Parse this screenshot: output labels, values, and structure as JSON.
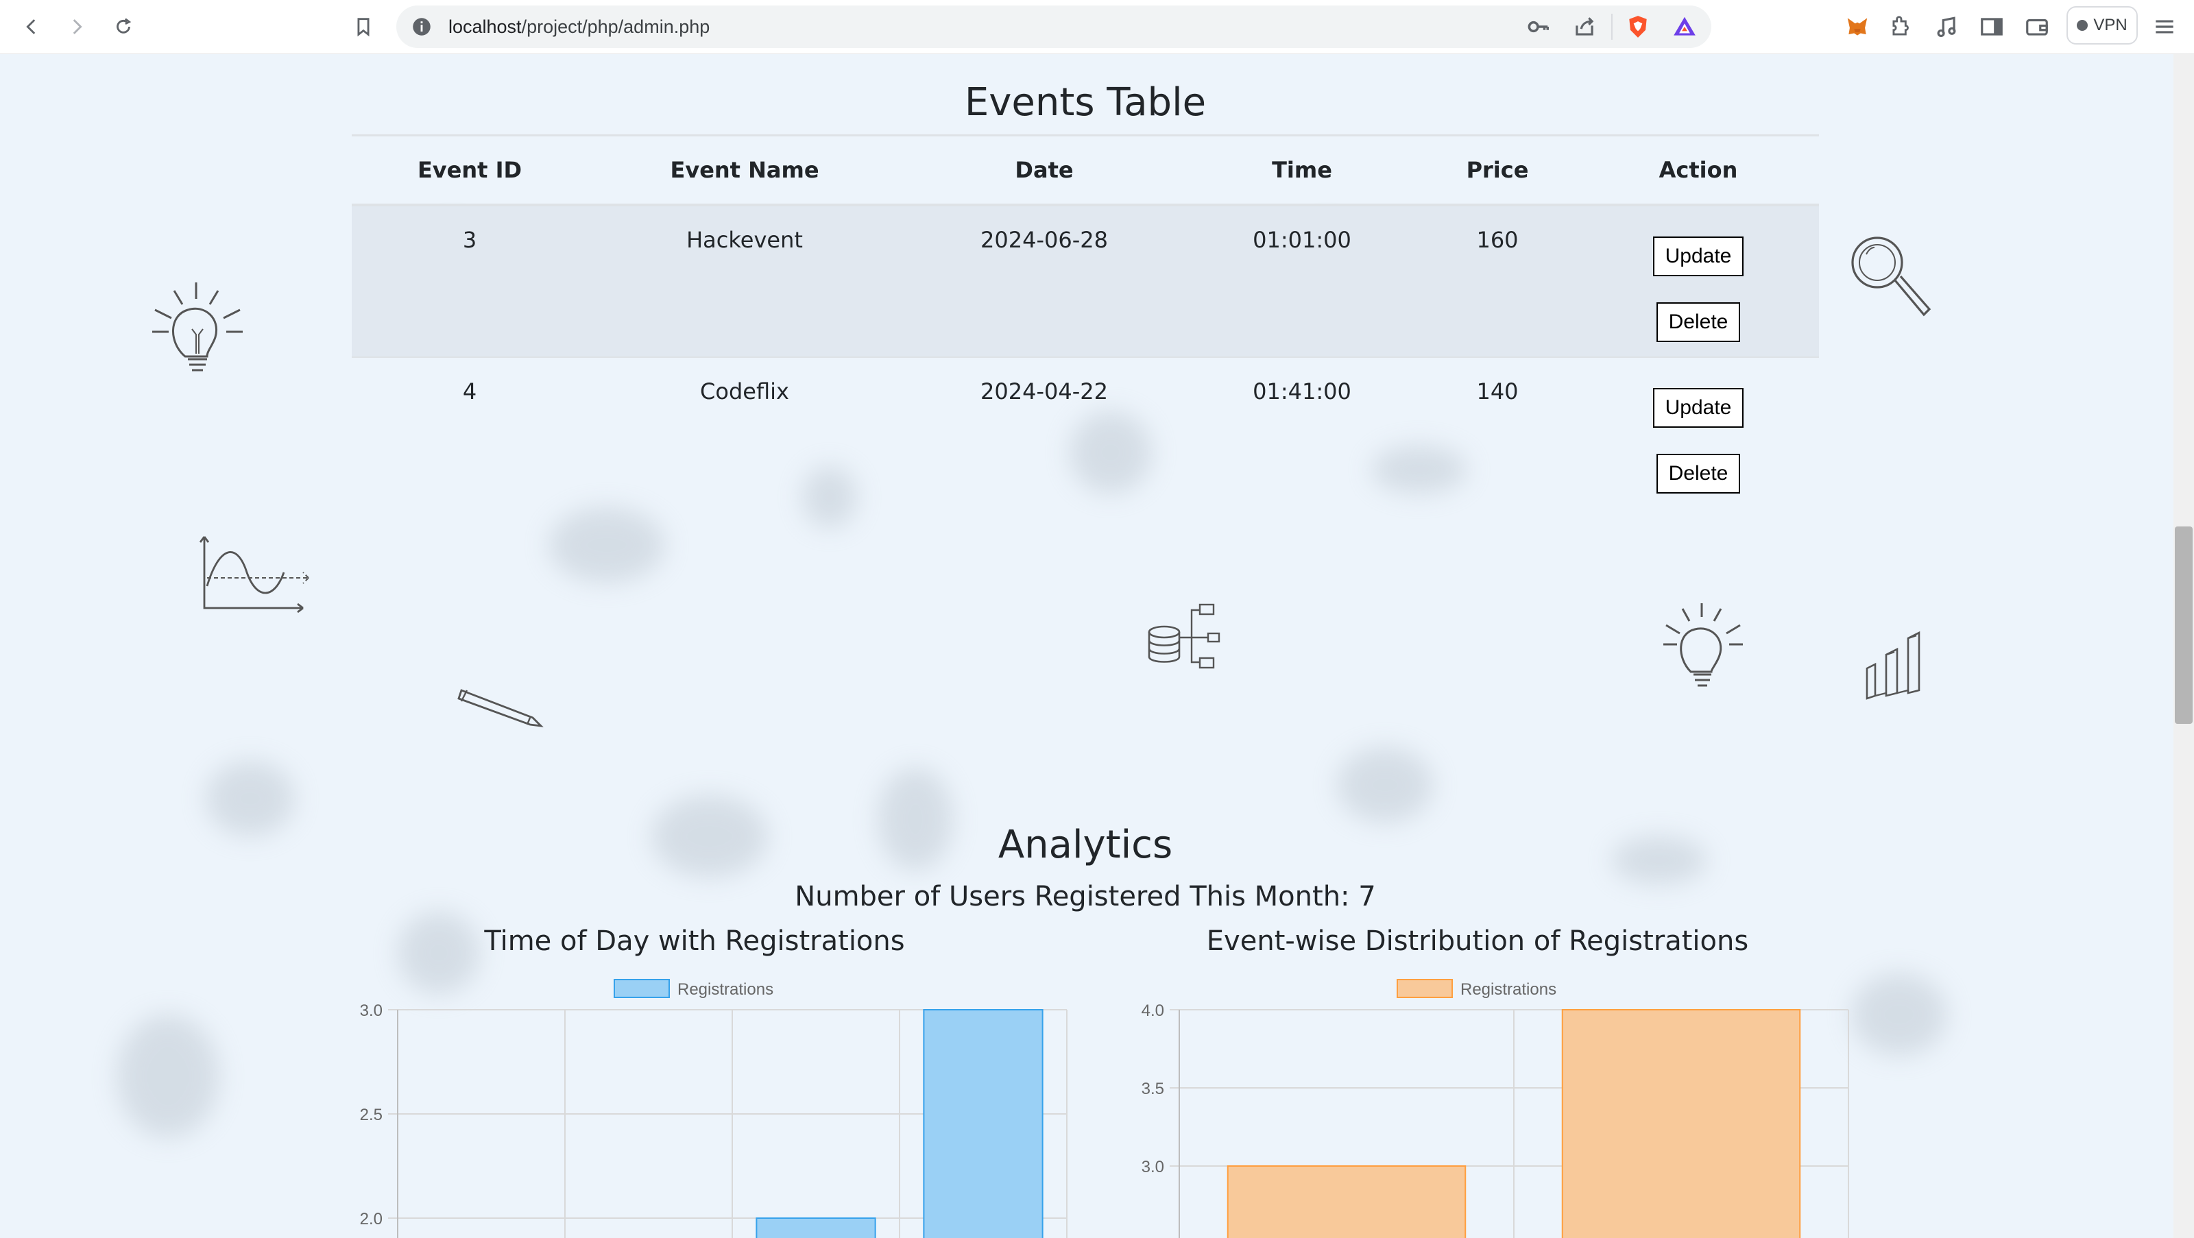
{
  "browser": {
    "url_host": "localhost",
    "url_path": "/project/php/admin.php",
    "vpn_label": "VPN",
    "icons": [
      "back-icon",
      "forward-icon",
      "reload-icon",
      "bookmark-icon",
      "info-icon",
      "key-icon",
      "share-icon",
      "brave-shield-icon",
      "brave-rewards-icon",
      "metamask-icon",
      "extensions-icon",
      "media-icon",
      "sidebar-icon",
      "wallet-icon",
      "menu-icon"
    ]
  },
  "events": {
    "title": "Events Table",
    "columns": [
      "Event ID",
      "Event Name",
      "Date",
      "Time",
      "Price",
      "Action"
    ],
    "rows": [
      {
        "id": "3",
        "name": "Hackevent",
        "date": "2024-06-28",
        "time": "01:01:00",
        "price": "160"
      },
      {
        "id": "4",
        "name": "Codeflix",
        "date": "2024-04-22",
        "time": "01:41:00",
        "price": "140"
      }
    ],
    "update_label": "Update",
    "delete_label": "Delete"
  },
  "analytics": {
    "title": "Analytics",
    "users_line": "Number of Users Registered This Month: 7"
  },
  "chart_data": [
    {
      "type": "bar",
      "title": "Time of Day with Registrations",
      "series": [
        {
          "name": "Registrations",
          "values": [
            null,
            null,
            2,
            3
          ]
        }
      ],
      "categories": [
        "",
        "",
        "",
        ""
      ],
      "y_ticks": [
        "3.0",
        "2.5",
        "2.0"
      ],
      "ylim": [
        1.9,
        3.0
      ],
      "color": "#9ad0f5",
      "border_color": "#36a2eb",
      "legend": "top-center",
      "grid": true
    },
    {
      "type": "bar",
      "title": "Event-wise Distribution of Registrations",
      "series": [
        {
          "name": "Registrations",
          "values": [
            3,
            4
          ]
        }
      ],
      "categories": [
        "",
        ""
      ],
      "y_ticks": [
        "4.0",
        "3.5",
        "3.0"
      ],
      "ylim": [
        2.55,
        4.0
      ],
      "color": "#f8c99a",
      "border_color": "#ff9f40",
      "legend": "top-center",
      "grid": true
    }
  ]
}
